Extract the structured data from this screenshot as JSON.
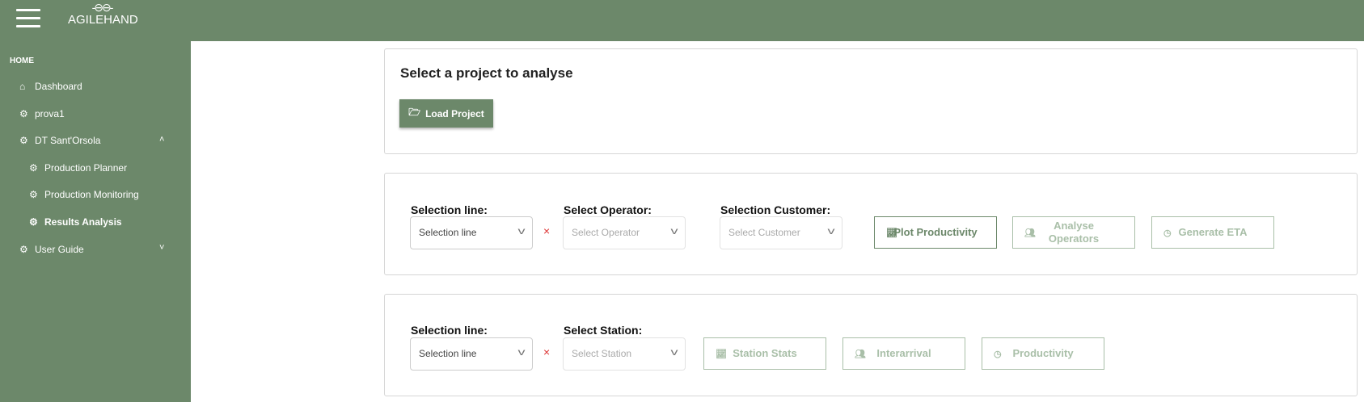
{
  "header": {
    "brand": "AGILEHAND",
    "brand_mark": "-⊖⊖-"
  },
  "sidebar": {
    "section": "HOME",
    "items": [
      {
        "label": "Dashboard",
        "icon": "home-icon"
      },
      {
        "label": "prova1",
        "icon": "gear-icon"
      },
      {
        "label": "DT Sant'Orsola",
        "icon": "gear-icon"
      },
      {
        "label": "Production Planner",
        "icon": "gear-icon"
      },
      {
        "label": "Production Monitoring",
        "icon": "gear-icon"
      },
      {
        "label": "Results Analysis",
        "icon": "gear-icon"
      },
      {
        "label": "User Guide",
        "icon": "gear-icon"
      }
    ]
  },
  "project": {
    "title": "Select a project to analyse",
    "load_label": "Load Project"
  },
  "operators": {
    "line_label": "Selection line:",
    "line_placeholder": "Selection line",
    "operator_label": "Select Operator:",
    "operator_placeholder": "Select Operator",
    "customer_label": "Selection Customer:",
    "customer_placeholder": "Select Customer",
    "plot": "Plot Productivity",
    "analyse": "Analyse Operators",
    "eta": "Generate ETA",
    "clear": "×"
  },
  "stations": {
    "line_label": "Selection line:",
    "line_placeholder": "Selection line",
    "station_label": "Select Station:",
    "station_placeholder": "Select Station",
    "stats": "Station Stats",
    "interarrival": "Interarrival",
    "productivity": "Productivity",
    "clear": "×"
  }
}
